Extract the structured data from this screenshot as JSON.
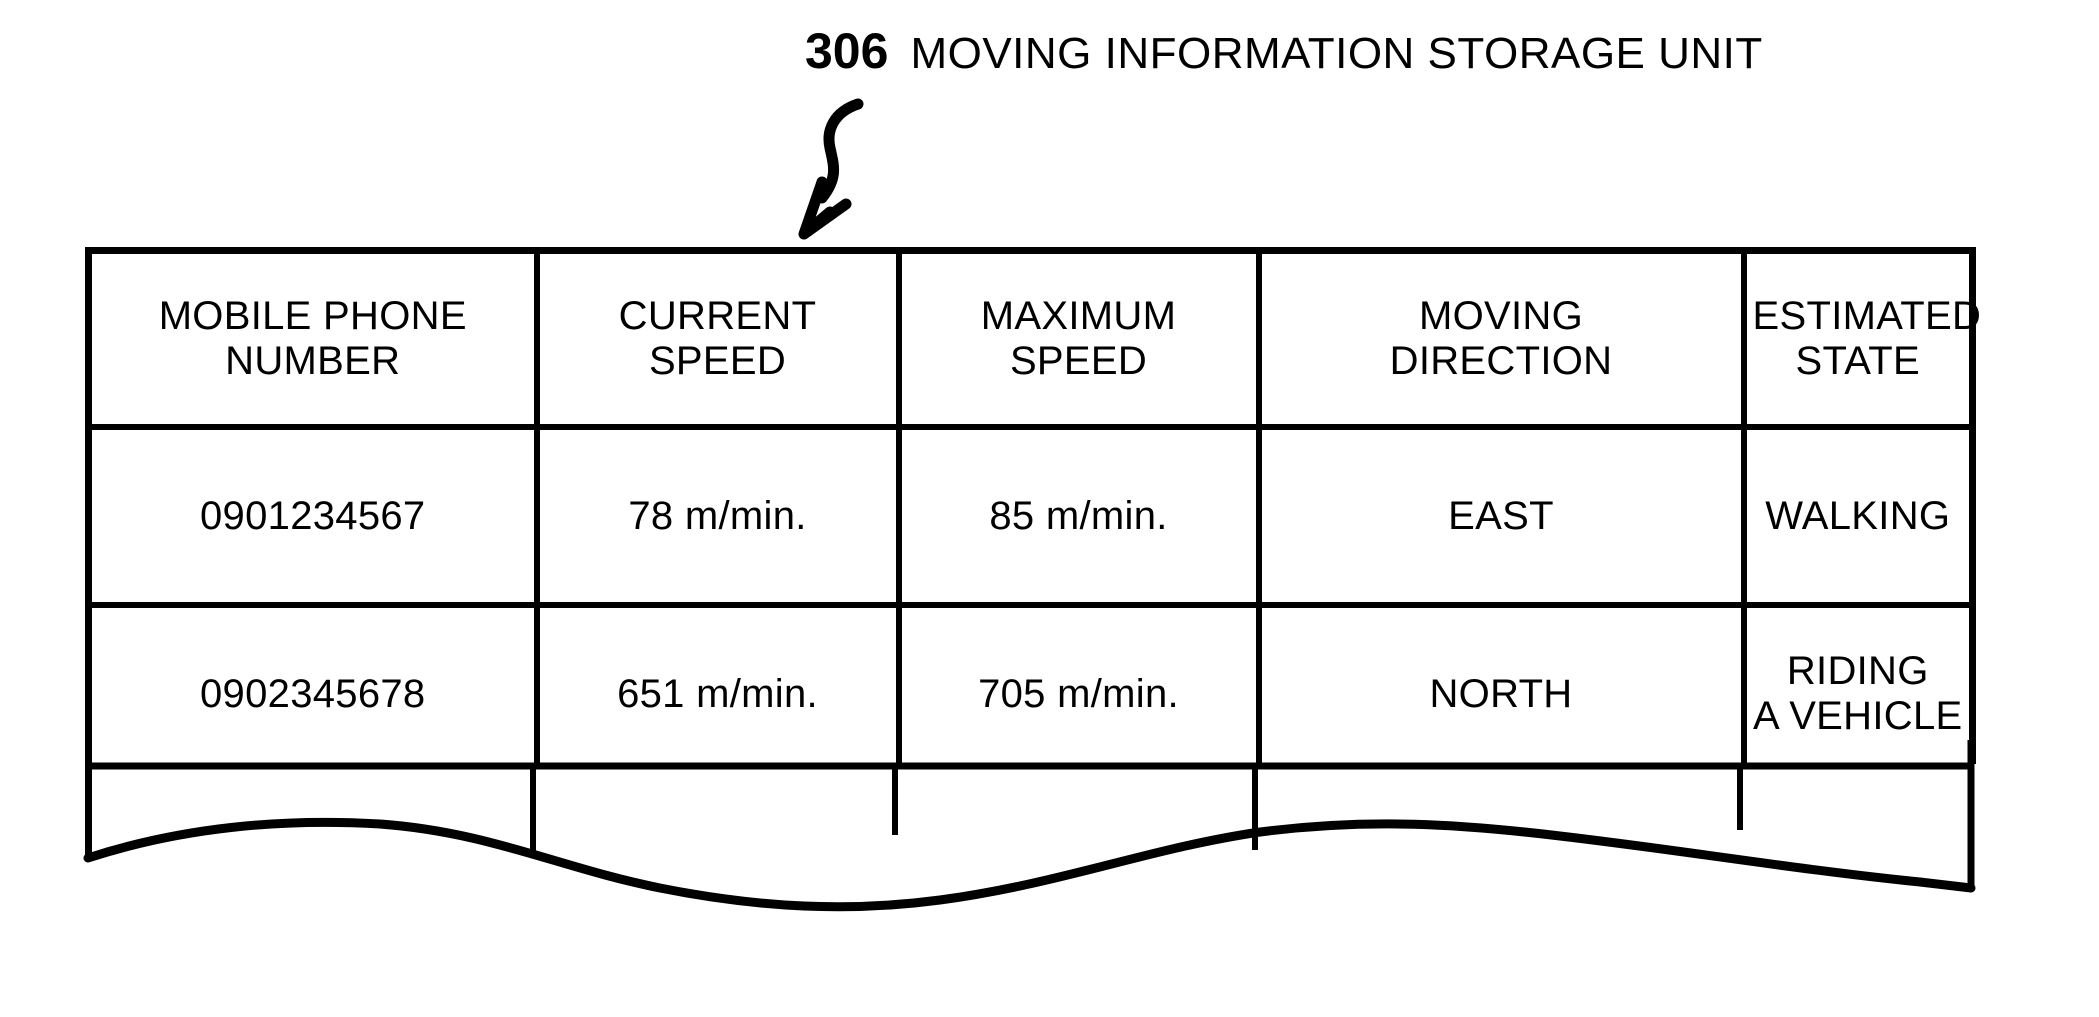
{
  "figure": {
    "reference_numeral": "306",
    "label": "MOVING INFORMATION STORAGE UNIT",
    "arrow": "curved-arrow-down-left",
    "line_color": "#000000",
    "background_color": "#ffffff"
  },
  "table": {
    "name": "moving information storage unit table",
    "columns": [
      {
        "header_line1": "MOBILE PHONE",
        "header_line2": "NUMBER"
      },
      {
        "header_line1": "CURRENT",
        "header_line2": "SPEED"
      },
      {
        "header_line1": "MAXIMUM",
        "header_line2": "SPEED"
      },
      {
        "header_line1": "MOVING",
        "header_line2": "DIRECTION"
      },
      {
        "header_line1": "ESTIMATED",
        "header_line2": "STATE"
      }
    ],
    "rows": [
      {
        "mobile_phone_number": "0901234567",
        "current_speed": "78 m/min.",
        "maximum_speed": "85 m/min.",
        "moving_direction": "EAST",
        "estimated_state_line1": "WALKING",
        "estimated_state_line2": ""
      },
      {
        "mobile_phone_number": "0902345678",
        "current_speed": "651 m/min.",
        "maximum_speed": "705 m/min.",
        "moving_direction": "NORTH",
        "estimated_state_line1": "RIDING",
        "estimated_state_line2": "A VEHICLE"
      }
    ],
    "truncated_row": {
      "mobile_phone_number": "",
      "current_speed": "",
      "maximum_speed": "",
      "moving_direction": "",
      "estimated_state": ""
    }
  }
}
